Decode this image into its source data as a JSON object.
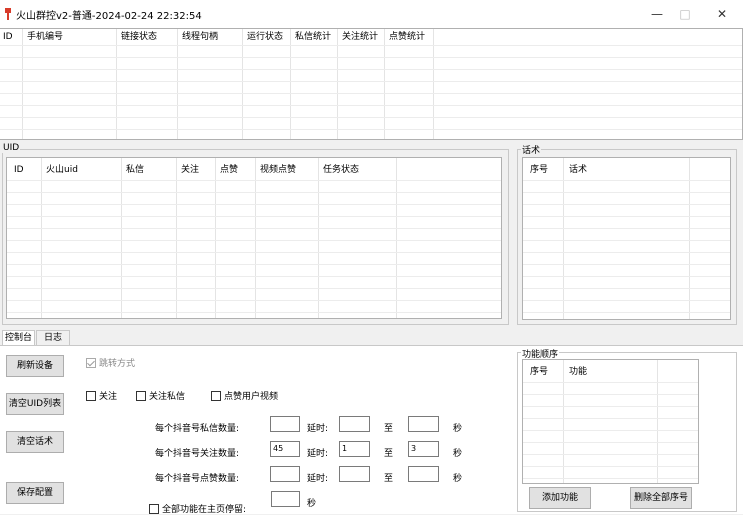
{
  "window": {
    "title": "火山群控v2-普通-2024-02-24 22:32:54",
    "minimize": "—",
    "maximize": "□",
    "close": "✕"
  },
  "device_table": {
    "headers": [
      "ID",
      "手机编号",
      "链接状态",
      "线程句柄",
      "运行状态",
      "私信统计",
      "关注统计",
      "点赞统计"
    ]
  },
  "uid_section": {
    "label": "UID",
    "headers": [
      "ID",
      "火山uid",
      "私信",
      "关注",
      "点赞",
      "视频点赞",
      "任务状态"
    ]
  },
  "script_section": {
    "label": "话术",
    "headers": [
      "序号",
      "话术"
    ]
  },
  "tabs": {
    "console": "控制台",
    "log": "日志"
  },
  "buttons": {
    "refresh": "刷新设备",
    "clear_uid": "清空UID列表",
    "clear_script": "清空话术",
    "save": "保存配置"
  },
  "options": {
    "jump_mode": "跳转方式",
    "jump_mode_checked": true,
    "follow": "关注",
    "follow_dm": "关注私信",
    "like_videos": "点赞用户视频",
    "all_stay_home": "全部功能在主页停留:"
  },
  "settings": {
    "dm_label": "每个抖音号私信数量:",
    "follow_label": "每个抖音号关注数量:",
    "like_label": "每个抖音号点赞数量:",
    "delay_label": "延时:",
    "to_label": "至",
    "sec_label": "秒",
    "dm_count": "",
    "dm_delay_min": "",
    "dm_delay_max": "",
    "follow_count": "45",
    "follow_delay_min": "1",
    "follow_delay_max": "3",
    "like_count": "",
    "like_delay_min": "",
    "like_delay_max": "",
    "stay_value": ""
  },
  "func_section": {
    "label": "功能顺序",
    "headers": [
      "序号",
      "功能"
    ],
    "add_button": "添加功能",
    "delete_button": "删除全部序号"
  }
}
